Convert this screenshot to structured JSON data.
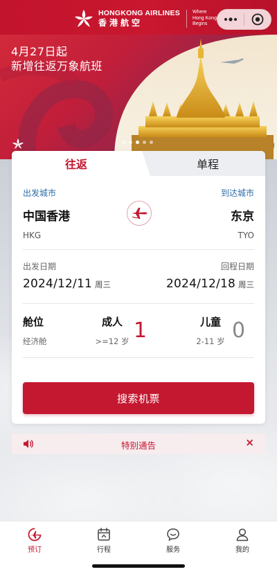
{
  "header": {
    "brand_en": "HONGKONG AIRLINES",
    "brand_cn": "香港航空",
    "tagline": [
      "Where",
      "Hong Kong",
      "Begins"
    ],
    "more_icon": "more-dots-icon",
    "close_icon": "target-close-icon"
  },
  "banner": {
    "line1": "4月27日起",
    "line2": "新增往返万象航班",
    "slides": 5,
    "active_slide": 1
  },
  "booking": {
    "tabs": {
      "round_trip": "往返",
      "one_way": "单程"
    },
    "origin_label": "出发城市",
    "destination_label": "到达城市",
    "origin_city": "中国香港",
    "destination_city": "东京",
    "origin_code": "HKG",
    "destination_code": "TYO",
    "depart_label": "出发日期",
    "return_label": "回程日期",
    "depart_date": "2024/12/11",
    "depart_weekday": "周三",
    "return_date": "2024/12/18",
    "return_weekday": "周三",
    "cabin_label": "舱位",
    "cabin_value": "经济舱",
    "adult_label": "成人",
    "adult_age": ">=12 岁",
    "adult_count": "1",
    "child_label": "儿童",
    "child_age": "2-11 岁",
    "child_count": "0",
    "search_label": "搜索机票"
  },
  "notice": {
    "text": "特别通告",
    "close": "×"
  },
  "tabbar": [
    {
      "label": "预订",
      "icon": "plane-booking-icon",
      "active": true
    },
    {
      "label": "行程",
      "icon": "calendar-trip-icon",
      "active": false
    },
    {
      "label": "服务",
      "icon": "chat-service-icon",
      "active": false
    },
    {
      "label": "我的",
      "icon": "user-profile-icon",
      "active": false
    }
  ],
  "colors": {
    "brand_red": "#c41730",
    "link_blue": "#2d6ea7"
  }
}
